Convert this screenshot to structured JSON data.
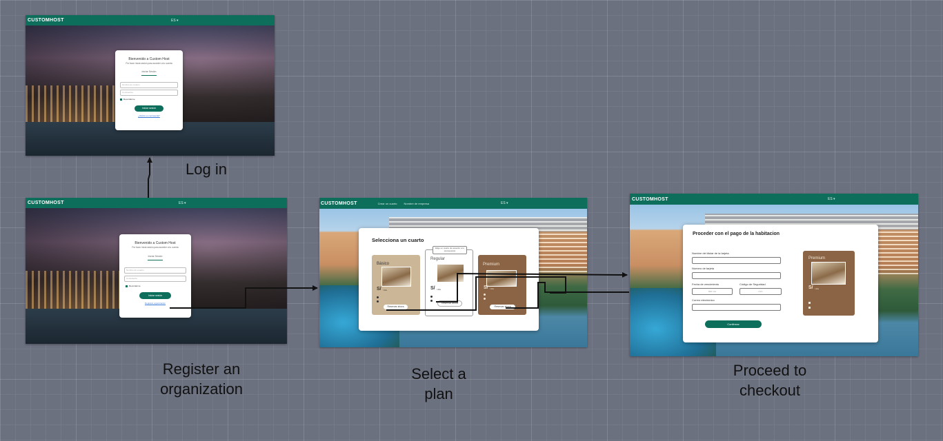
{
  "brand": "CUSTOMHOST",
  "login_screen": {
    "language": "ES ▾",
    "welcome": "Bienvenido a Custom Host",
    "subtitle": "Por favor inicia sesión para acceder a tu cuenta",
    "tab": "Iniciar Sesión",
    "username_placeholder": "Nombre de usuario",
    "password_placeholder": "Contraseña",
    "remember": "Recordarme",
    "submit": "Iniciar sesión",
    "link": "¿Olvidó su contraseña?"
  },
  "register_screen": {
    "language": "ES ▾",
    "welcome": "Bienvenido a Custom Host",
    "subtitle": "Por favor inicia sesión para acceder a tu cuenta",
    "tab": "Iniciar Sesión",
    "username_placeholder": "Nombre de usuario",
    "password_placeholder": "Contraseña",
    "remember": "Recordarme",
    "submit": "Iniciar sesión",
    "link": "Registrar organización"
  },
  "plan_screen": {
    "nav": [
      "Crear un cuarto",
      "Nombre de empresa"
    ],
    "language": "ES ▾",
    "title": "Selecciona un cuarto",
    "tooltip": "Elige un cuarto de acuerdo a tu presupuesto",
    "plans": [
      {
        "name": "Básico",
        "price": "S/",
        "per": "/ día",
        "button": "Reservar ahora",
        "color": "#cbb698"
      },
      {
        "name": "Regular",
        "price": "S/",
        "per": "/ día",
        "button": "Reservar ahora",
        "color": "#ffffff"
      },
      {
        "name": "Premium",
        "price": "S/",
        "per": "/ día",
        "button": "Reservar ahora",
        "color": "#8a6445"
      }
    ]
  },
  "checkout_screen": {
    "language": "ES ▾",
    "title": "Proceder con el pago de la habitacion",
    "fields": {
      "cardholder": "Nombre del titular de la tarjeta",
      "card_number": "Número de tarjeta",
      "expiry": "Fecha de vencimiento",
      "security": "Código de Seguridad",
      "email": "Correo electrónico"
    },
    "expiry_placeholder": "MM / AA",
    "security_placeholder": "CVC",
    "confirm": "Confirmar",
    "plan_name": "Premium",
    "plan_price": "S/",
    "plan_per": "/ día"
  },
  "captions": {
    "login": "Log in",
    "register": "Register an organization",
    "select": "Select a plan",
    "checkout": "Proceed to checkout"
  },
  "colors": {
    "brand_green": "#0e6e5c",
    "canvas": "#6c7180",
    "connector": "#111111"
  }
}
